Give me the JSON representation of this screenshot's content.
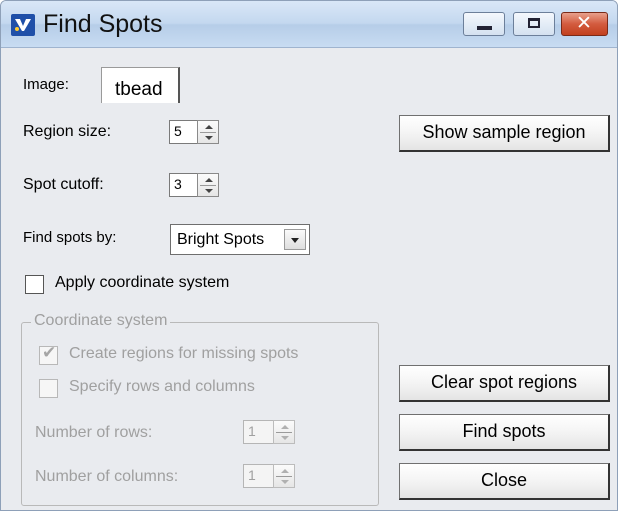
{
  "window": {
    "title": "Find Spots"
  },
  "image": {
    "label": "Image:",
    "tab": "tbead"
  },
  "region_size": {
    "label": "Region size:",
    "value": "5"
  },
  "spot_cutoff": {
    "label": "Spot cutoff:",
    "value": "3"
  },
  "find_by": {
    "label": "Find spots by:",
    "selected": "Bright Spots"
  },
  "apply_coord": {
    "label": "Apply coordinate system",
    "checked": false
  },
  "coord_group": {
    "legend": "Coordinate system",
    "create_regions": {
      "label": "Create regions for missing spots",
      "checked": true,
      "enabled": false
    },
    "specify_rows": {
      "label": "Specify rows and columns",
      "checked": false,
      "enabled": false
    },
    "num_rows": {
      "label": "Number of rows:",
      "value": "1"
    },
    "num_cols": {
      "label": "Number of columns:",
      "value": "1"
    }
  },
  "buttons": {
    "show_sample": "Show sample region",
    "clear_regions": "Clear spot regions",
    "find_spots": "Find spots",
    "close": "Close"
  },
  "icons": {
    "app": "app-logo-icon",
    "minimize": "minimize-icon",
    "maximize": "maximize-icon",
    "close": "close-icon"
  }
}
